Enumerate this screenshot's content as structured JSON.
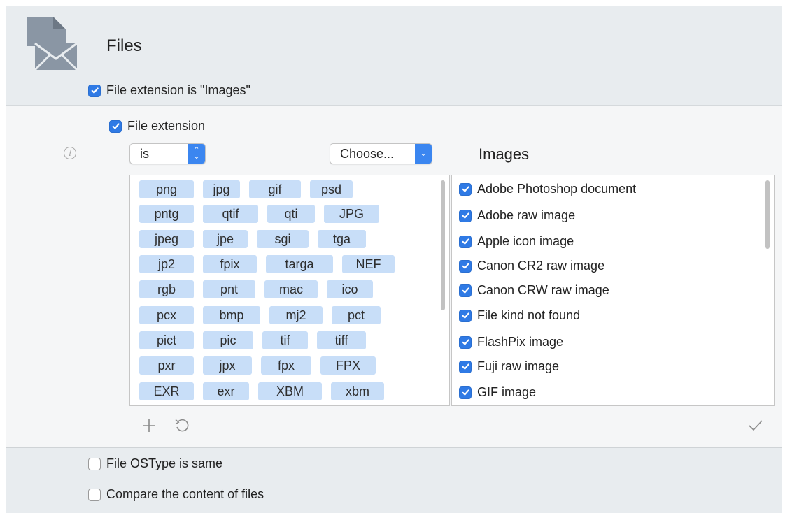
{
  "header": {
    "title": "Files",
    "rule_checkbox": {
      "label": "File extension is \"Images\"",
      "checked": true
    }
  },
  "criteria": {
    "file_extension": {
      "label": "File extension",
      "checked": true
    },
    "operator_popup": {
      "value": "is"
    },
    "choose_popup": {
      "value": "Choose..."
    },
    "images_label": "Images",
    "extensions": [
      [
        "png",
        "jpg",
        "gif",
        "psd"
      ],
      [
        "pntg",
        "qtif",
        "qti",
        "JPG"
      ],
      [
        "jpeg",
        "jpe",
        "sgi",
        "tga"
      ],
      [
        "jp2",
        "fpix",
        "targa",
        "NEF"
      ],
      [
        "rgb",
        "pnt",
        "mac",
        "ico"
      ],
      [
        "pcx",
        "bmp",
        "mj2",
        "pct"
      ],
      [
        "pict",
        "pic",
        "tif",
        "tiff"
      ],
      [
        "pxr",
        "jpx",
        "fpx",
        "FPX"
      ],
      [
        "EXR",
        "exr",
        "XBM",
        "xbm"
      ]
    ],
    "kinds": [
      {
        "label": "Adobe Photoshop document",
        "checked": true
      },
      {
        "label": "Adobe raw image",
        "checked": true
      },
      {
        "label": "Apple icon image",
        "checked": true
      },
      {
        "label": "Canon CR2 raw image",
        "checked": true
      },
      {
        "label": "Canon CRW raw image",
        "checked": true
      },
      {
        "label": "File kind not found",
        "checked": true
      },
      {
        "label": "FlashPix image",
        "checked": true
      },
      {
        "label": "Fuji raw image",
        "checked": true
      },
      {
        "label": "GIF image",
        "checked": true
      }
    ]
  },
  "toolbar": {
    "add_icon": "plus-icon",
    "reset_icon": "undo-icon",
    "confirm_icon": "checkmark-icon"
  },
  "footer": {
    "ostype": {
      "label": "File OSType is same",
      "checked": false
    },
    "content": {
      "label": "Compare the content of files",
      "checked": false
    }
  },
  "colors": {
    "accent": "#2f7ae5",
    "tag_bg": "#c8def8",
    "band": "#e8ecef"
  }
}
